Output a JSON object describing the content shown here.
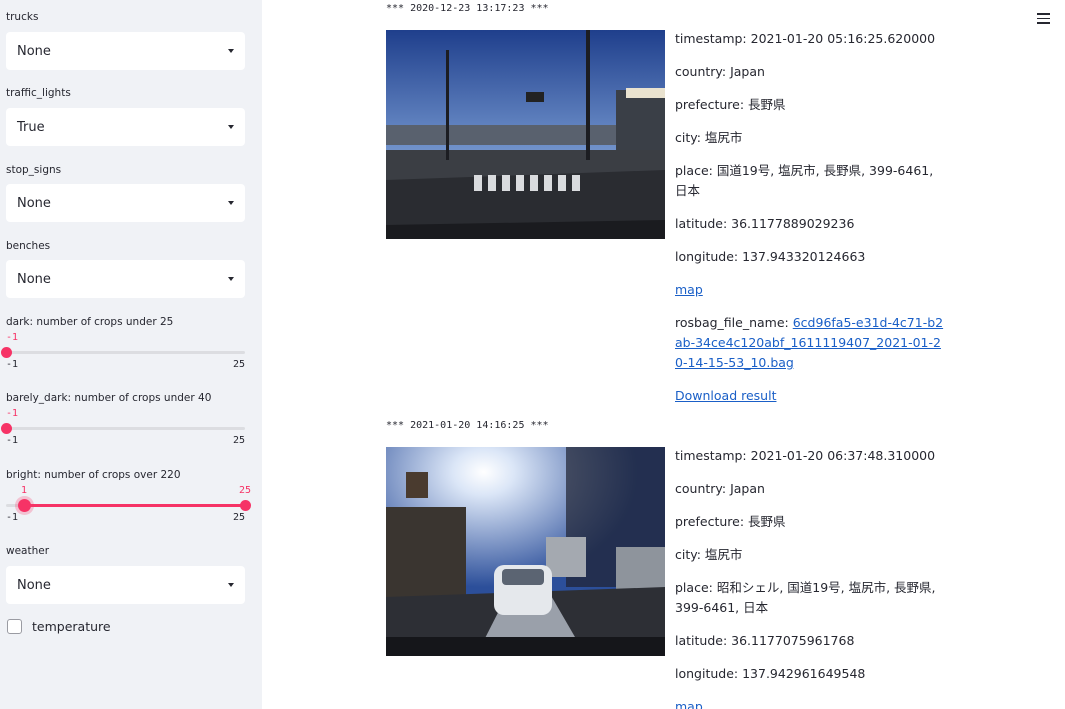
{
  "sidebar": {
    "filters": [
      {
        "label": "trucks",
        "value": "None"
      },
      {
        "label": "traffic_lights",
        "value": "True"
      },
      {
        "label": "stop_signs",
        "value": "None"
      },
      {
        "label": "benches",
        "value": "None"
      }
    ],
    "sliders": [
      {
        "label": "dark: number of crops under 25",
        "value": "-1",
        "min": "-1",
        "max": "25"
      },
      {
        "label": "barely_dark: number of crops under 40",
        "value": "-1",
        "min": "-1",
        "max": "25"
      },
      {
        "label": "bright: number of crops over 220",
        "value_low": "1",
        "value_high": "25",
        "min": "-1",
        "max": "25"
      }
    ],
    "weather": {
      "label": "weather",
      "value": "None"
    },
    "temperature": {
      "label": "temperature",
      "checked": false
    }
  },
  "accent_color": "#f63366",
  "records": [
    {
      "header": "*** 2020-12-23 13:17:23 ***",
      "timestamp": "timestamp: 2021-01-20 05:16:25.620000",
      "country": "country: Japan",
      "prefecture": "prefecture: 長野県",
      "city": "city: 塩尻市",
      "place": "place: 国道19号, 塩尻市, 長野県, 399-6461, 日本",
      "latitude": "latitude: 36.1177889029236",
      "longitude": "longitude: 137.943320124663",
      "map_label": "map",
      "rosbag_label": "rosbag_file_name: ",
      "rosbag_link": "6cd96fa5-e31d-4c71-b2ab-34ce4c120abf_1611119407_2021-01-20-14-15-53_10.bag",
      "download_label": "Download result"
    },
    {
      "header": "*** 2021-01-20 14:16:25 ***",
      "timestamp": "timestamp: 2021-01-20 06:37:48.310000",
      "country": "country: Japan",
      "prefecture": "prefecture: 長野県",
      "city": "city: 塩尻市",
      "place": "place: 昭和シェル, 国道19号, 塩尻市, 長野県, 399-6461, 日本",
      "latitude": "latitude: 36.1177075961768",
      "longitude": "longitude: 137.942961649548",
      "map_label": "map"
    }
  ]
}
